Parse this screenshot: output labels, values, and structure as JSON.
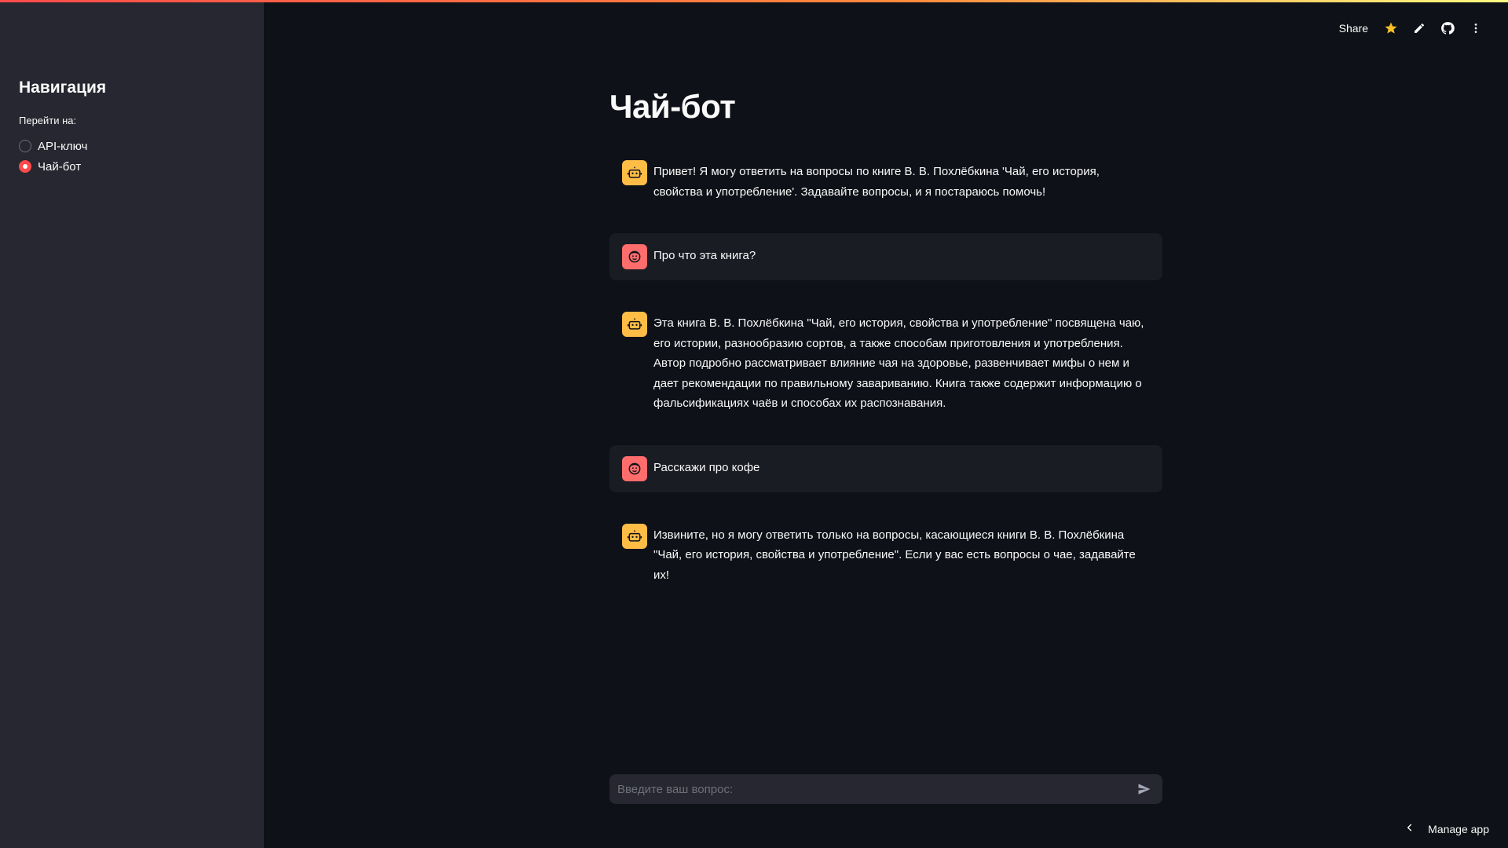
{
  "sidebar": {
    "title": "Навигация",
    "radio_label": "Перейти на:",
    "options": [
      {
        "label": "API-ключ",
        "selected": false
      },
      {
        "label": "Чай-бот",
        "selected": true
      }
    ]
  },
  "toolbar": {
    "share_label": "Share",
    "icons": [
      "star-icon",
      "edit-icon",
      "github-icon",
      "more-vertical-icon"
    ]
  },
  "main": {
    "title": "Чай-бот",
    "messages": [
      {
        "role": "assistant",
        "text": "Привет! Я могу ответить на вопросы по книге В. В. Похлёбкина 'Чай, его история, свойства и употребление'. Задавайте вопросы, и я постараюсь помочь!"
      },
      {
        "role": "user",
        "text": "Про что эта книга?"
      },
      {
        "role": "assistant",
        "text": "Эта книга В. В. Похлёбкина \"Чай, его история, свойства и употребление\" посвящена чаю, его истории, разнообразию сортов, а также способам приготовления и употребления. Автор подробно рассматривает влияние чая на здоровье, развенчивает мифы о нем и дает рекомендации по правильному завариванию. Книга также содержит информацию о фальсификациях чаёв и способах их распознавания."
      },
      {
        "role": "user",
        "text": "Расскажи про кофе"
      },
      {
        "role": "assistant",
        "text": "Извините, но я могу ответить только на вопросы, касающиеся книги В. В. Похлёбкина \"Чай, его история, свойства и употребление\". Если у вас есть вопросы о чае, задавайте их!"
      }
    ]
  },
  "chat_input": {
    "placeholder": "Введите ваш вопрос:",
    "value": ""
  },
  "footer": {
    "manage_label": "Manage app"
  },
  "colors": {
    "accent": "#ff4b4b",
    "bot_avatar": "#ffbd45",
    "user_avatar": "#ff6c6c",
    "background": "#0e1117",
    "sidebar": "#262730"
  }
}
